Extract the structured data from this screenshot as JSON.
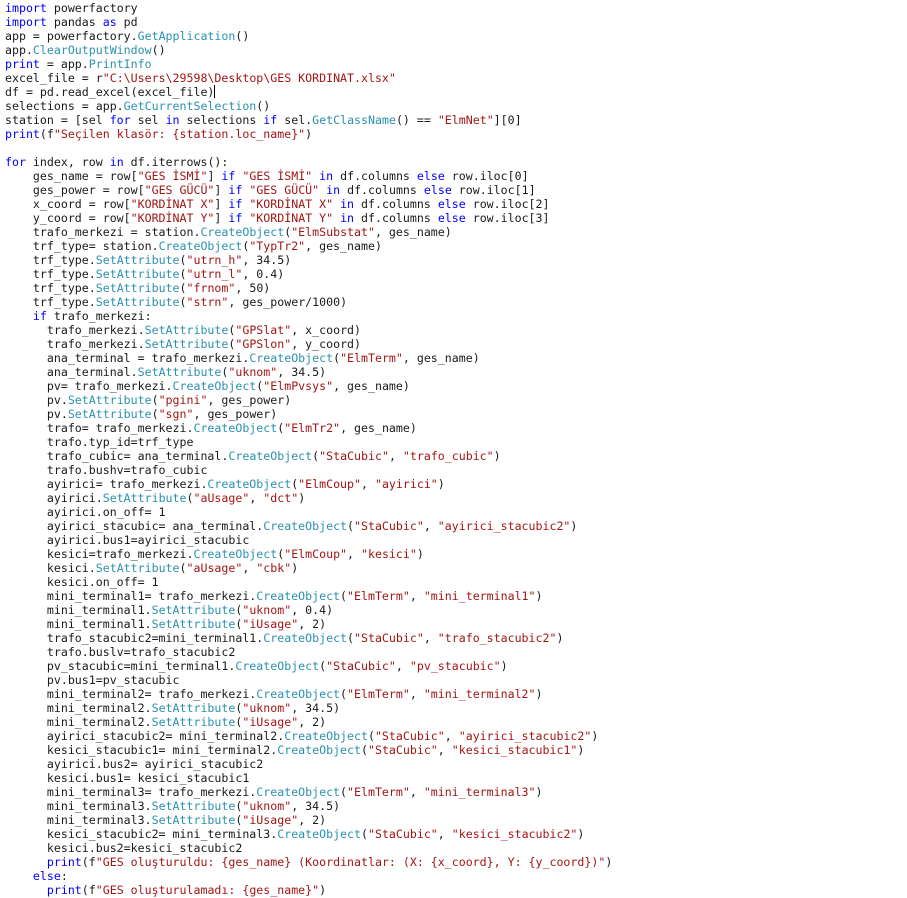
{
  "editor": {
    "lines": [
      [
        [
          "kw",
          "import"
        ],
        [
          "t",
          " powerfactory"
        ]
      ],
      [
        [
          "kw",
          "import"
        ],
        [
          "t",
          " pandas "
        ],
        [
          "kw",
          "as"
        ],
        [
          "t",
          " pd"
        ]
      ],
      [
        [
          "t",
          "app = powerfactory."
        ],
        [
          "fn",
          "GetApplication"
        ],
        [
          "t",
          "()"
        ]
      ],
      [
        [
          "t",
          "app."
        ],
        [
          "fn",
          "ClearOutputWindow"
        ],
        [
          "t",
          "()"
        ]
      ],
      [
        [
          "kw",
          "print"
        ],
        [
          "t",
          " = app."
        ],
        [
          "fn",
          "PrintInfo"
        ]
      ],
      [
        [
          "t",
          "excel_file = r"
        ],
        [
          "str",
          "\"C:\\Users\\29598\\Desktop\\GES KORDINAT.xlsx\""
        ]
      ],
      [
        [
          "t",
          "df = pd.read_excel(excel_file)"
        ]
      ],
      [
        [
          "t",
          "selections = app."
        ],
        [
          "fn",
          "GetCurrentSelection"
        ],
        [
          "t",
          "()"
        ]
      ],
      [
        [
          "t",
          "station = [sel "
        ],
        [
          "kw",
          "for"
        ],
        [
          "t",
          " sel "
        ],
        [
          "kw",
          "in"
        ],
        [
          "t",
          " selections "
        ],
        [
          "kw",
          "if"
        ],
        [
          "t",
          " sel."
        ],
        [
          "fn",
          "GetClassName"
        ],
        [
          "t",
          "() == "
        ],
        [
          "str",
          "\"ElmNet\""
        ],
        [
          "t",
          "][0]"
        ]
      ],
      [
        [
          "kw",
          "print"
        ],
        [
          "t",
          "(f"
        ],
        [
          "str",
          "\"Seçilen klasör: {station.loc_name}\""
        ],
        [
          "t",
          ")"
        ]
      ],
      [],
      [
        [
          "kw",
          "for"
        ],
        [
          "t",
          " index, row "
        ],
        [
          "kw",
          "in"
        ],
        [
          "t",
          " df.iterrows():"
        ]
      ],
      [
        [
          "t",
          "    ges_name = row["
        ],
        [
          "str",
          "\"GES İSMİ\""
        ],
        [
          "t",
          "] "
        ],
        [
          "kw",
          "if"
        ],
        [
          "t",
          " "
        ],
        [
          "str",
          "\"GES İSMİ\""
        ],
        [
          "t",
          " "
        ],
        [
          "kw",
          "in"
        ],
        [
          "t",
          " df.columns "
        ],
        [
          "kw",
          "else"
        ],
        [
          "t",
          " row.iloc[0]"
        ]
      ],
      [
        [
          "t",
          "    ges_power = row["
        ],
        [
          "str",
          "\"GES GÜCÜ\""
        ],
        [
          "t",
          "] "
        ],
        [
          "kw",
          "if"
        ],
        [
          "t",
          " "
        ],
        [
          "str",
          "\"GES GÜCÜ\""
        ],
        [
          "t",
          " "
        ],
        [
          "kw",
          "in"
        ],
        [
          "t",
          " df.columns "
        ],
        [
          "kw",
          "else"
        ],
        [
          "t",
          " row.iloc[1]"
        ]
      ],
      [
        [
          "t",
          "    x_coord = row["
        ],
        [
          "str",
          "\"KORDİNAT X\""
        ],
        [
          "t",
          "] "
        ],
        [
          "kw",
          "if"
        ],
        [
          "t",
          " "
        ],
        [
          "str",
          "\"KORDİNAT X\""
        ],
        [
          "t",
          " "
        ],
        [
          "kw",
          "in"
        ],
        [
          "t",
          " df.columns "
        ],
        [
          "kw",
          "else"
        ],
        [
          "t",
          " row.iloc[2]"
        ]
      ],
      [
        [
          "t",
          "    y_coord = row["
        ],
        [
          "str",
          "\"KORDİNAT Y\""
        ],
        [
          "t",
          "] "
        ],
        [
          "kw",
          "if"
        ],
        [
          "t",
          " "
        ],
        [
          "str",
          "\"KORDİNAT Y\""
        ],
        [
          "t",
          " "
        ],
        [
          "kw",
          "in"
        ],
        [
          "t",
          " df.columns "
        ],
        [
          "kw",
          "else"
        ],
        [
          "t",
          " row.iloc[3]"
        ]
      ],
      [
        [
          "t",
          "    trafo_merkezi = station."
        ],
        [
          "fn",
          "CreateObject"
        ],
        [
          "t",
          "("
        ],
        [
          "str",
          "\"ElmSubstat\""
        ],
        [
          "t",
          ", ges_name)"
        ]
      ],
      [
        [
          "t",
          "    trf_type= station."
        ],
        [
          "fn",
          "CreateObject"
        ],
        [
          "t",
          "("
        ],
        [
          "str",
          "\"TypTr2\""
        ],
        [
          "t",
          ", ges_name)"
        ]
      ],
      [
        [
          "t",
          "    trf_type."
        ],
        [
          "fn",
          "SetAttribute"
        ],
        [
          "t",
          "("
        ],
        [
          "str",
          "\"utrn_h\""
        ],
        [
          "t",
          ", 34.5)"
        ]
      ],
      [
        [
          "t",
          "    trf_type."
        ],
        [
          "fn",
          "SetAttribute"
        ],
        [
          "t",
          "("
        ],
        [
          "str",
          "\"utrn_l\""
        ],
        [
          "t",
          ", 0.4)"
        ]
      ],
      [
        [
          "t",
          "    trf_type."
        ],
        [
          "fn",
          "SetAttribute"
        ],
        [
          "t",
          "("
        ],
        [
          "str",
          "\"frnom\""
        ],
        [
          "t",
          ", 50)"
        ]
      ],
      [
        [
          "t",
          "    trf_type."
        ],
        [
          "fn",
          "SetAttribute"
        ],
        [
          "t",
          "("
        ],
        [
          "str",
          "\"strn\""
        ],
        [
          "t",
          ", ges_power/1000)"
        ]
      ],
      [
        [
          "t",
          "    "
        ],
        [
          "kw",
          "if"
        ],
        [
          "t",
          " trafo_merkezi:"
        ]
      ],
      [
        [
          "t",
          "      trafo_merkezi."
        ],
        [
          "fn",
          "SetAttribute"
        ],
        [
          "t",
          "("
        ],
        [
          "str",
          "\"GPSlat\""
        ],
        [
          "t",
          ", x_coord)"
        ]
      ],
      [
        [
          "t",
          "      trafo_merkezi."
        ],
        [
          "fn",
          "SetAttribute"
        ],
        [
          "t",
          "("
        ],
        [
          "str",
          "\"GPSlon\""
        ],
        [
          "t",
          ", y_coord)"
        ]
      ],
      [
        [
          "t",
          "      ana_terminal = trafo_merkezi."
        ],
        [
          "fn",
          "CreateObject"
        ],
        [
          "t",
          "("
        ],
        [
          "str",
          "\"ElmTerm\""
        ],
        [
          "t",
          ", ges_name)"
        ]
      ],
      [
        [
          "t",
          "      ana_terminal."
        ],
        [
          "fn",
          "SetAttribute"
        ],
        [
          "t",
          "("
        ],
        [
          "str",
          "\"uknom\""
        ],
        [
          "t",
          ", 34.5)"
        ]
      ],
      [
        [
          "t",
          "      pv= trafo_merkezi."
        ],
        [
          "fn",
          "CreateObject"
        ],
        [
          "t",
          "("
        ],
        [
          "str",
          "\"ElmPvsys\""
        ],
        [
          "t",
          ", ges_name)"
        ]
      ],
      [
        [
          "t",
          "      pv."
        ],
        [
          "fn",
          "SetAttribute"
        ],
        [
          "t",
          "("
        ],
        [
          "str",
          "\"pgini\""
        ],
        [
          "t",
          ", ges_power)"
        ]
      ],
      [
        [
          "t",
          "      pv."
        ],
        [
          "fn",
          "SetAttribute"
        ],
        [
          "t",
          "("
        ],
        [
          "str",
          "\"sgn\""
        ],
        [
          "t",
          ", ges_power)"
        ]
      ],
      [
        [
          "t",
          "      trafo= trafo_merkezi."
        ],
        [
          "fn",
          "CreateObject"
        ],
        [
          "t",
          "("
        ],
        [
          "str",
          "\"ElmTr2\""
        ],
        [
          "t",
          ", ges_name)"
        ]
      ],
      [
        [
          "t",
          "      trafo.typ_id=trf_type"
        ]
      ],
      [
        [
          "t",
          "      trafo_cubic= ana_terminal."
        ],
        [
          "fn",
          "CreateObject"
        ],
        [
          "t",
          "("
        ],
        [
          "str",
          "\"StaCubic\""
        ],
        [
          "t",
          ", "
        ],
        [
          "str",
          "\"trafo_cubic\""
        ],
        [
          "t",
          ")"
        ]
      ],
      [
        [
          "t",
          "      trafo.bushv=trafo_cubic"
        ]
      ],
      [
        [
          "t",
          "      ayirici= trafo_merkezi."
        ],
        [
          "fn",
          "CreateObject"
        ],
        [
          "t",
          "("
        ],
        [
          "str",
          "\"ElmCoup\""
        ],
        [
          "t",
          ", "
        ],
        [
          "str",
          "\"ayirici\""
        ],
        [
          "t",
          ")"
        ]
      ],
      [
        [
          "t",
          "      ayirici."
        ],
        [
          "fn",
          "SetAttribute"
        ],
        [
          "t",
          "("
        ],
        [
          "str",
          "\"aUsage\""
        ],
        [
          "t",
          ", "
        ],
        [
          "str",
          "\"dct\""
        ],
        [
          "t",
          ")"
        ]
      ],
      [
        [
          "t",
          "      ayirici.on_off= 1"
        ]
      ],
      [
        [
          "t",
          "      ayirici_stacubic= ana_terminal."
        ],
        [
          "fn",
          "CreateObject"
        ],
        [
          "t",
          "("
        ],
        [
          "str",
          "\"StaCubic\""
        ],
        [
          "t",
          ", "
        ],
        [
          "str",
          "\"ayirici_stacubic2\""
        ],
        [
          "t",
          ")"
        ]
      ],
      [
        [
          "t",
          "      ayirici.bus1=ayirici_stacubic"
        ]
      ],
      [
        [
          "t",
          "      kesici=trafo_merkezi."
        ],
        [
          "fn",
          "CreateObject"
        ],
        [
          "t",
          "("
        ],
        [
          "str",
          "\"ElmCoup\""
        ],
        [
          "t",
          ", "
        ],
        [
          "str",
          "\"kesici\""
        ],
        [
          "t",
          ")"
        ]
      ],
      [
        [
          "t",
          "      kesici."
        ],
        [
          "fn",
          "SetAttribute"
        ],
        [
          "t",
          "("
        ],
        [
          "str",
          "\"aUsage\""
        ],
        [
          "t",
          ", "
        ],
        [
          "str",
          "\"cbk\""
        ],
        [
          "t",
          ")"
        ]
      ],
      [
        [
          "t",
          "      kesici.on_off= 1"
        ]
      ],
      [
        [
          "t",
          "      mini_terminal1= trafo_merkezi."
        ],
        [
          "fn",
          "CreateObject"
        ],
        [
          "t",
          "("
        ],
        [
          "str",
          "\"ElmTerm\""
        ],
        [
          "t",
          ", "
        ],
        [
          "str",
          "\"mini_terminal1\""
        ],
        [
          "t",
          ")"
        ]
      ],
      [
        [
          "t",
          "      mini_terminal1."
        ],
        [
          "fn",
          "SetAttribute"
        ],
        [
          "t",
          "("
        ],
        [
          "str",
          "\"uknom\""
        ],
        [
          "t",
          ", 0.4)"
        ]
      ],
      [
        [
          "t",
          "      mini_terminal1."
        ],
        [
          "fn",
          "SetAttribute"
        ],
        [
          "t",
          "("
        ],
        [
          "str",
          "\"iUsage\""
        ],
        [
          "t",
          ", 2)"
        ]
      ],
      [
        [
          "t",
          "      trafo_stacubic2=mini_terminal1."
        ],
        [
          "fn",
          "CreateObject"
        ],
        [
          "t",
          "("
        ],
        [
          "str",
          "\"StaCubic\""
        ],
        [
          "t",
          ", "
        ],
        [
          "str",
          "\"trafo_stacubic2\""
        ],
        [
          "t",
          ")"
        ]
      ],
      [
        [
          "t",
          "      trafo.buslv=trafo_stacubic2"
        ]
      ],
      [
        [
          "t",
          "      pv_stacubic=mini_terminal1."
        ],
        [
          "fn",
          "CreateObject"
        ],
        [
          "t",
          "("
        ],
        [
          "str",
          "\"StaCubic\""
        ],
        [
          "t",
          ", "
        ],
        [
          "str",
          "\"pv_stacubic\""
        ],
        [
          "t",
          ")"
        ]
      ],
      [
        [
          "t",
          "      pv.bus1=pv_stacubic"
        ]
      ],
      [
        [
          "t",
          "      mini_terminal2= trafo_merkezi."
        ],
        [
          "fn",
          "CreateObject"
        ],
        [
          "t",
          "("
        ],
        [
          "str",
          "\"ElmTerm\""
        ],
        [
          "t",
          ", "
        ],
        [
          "str",
          "\"mini_terminal2\""
        ],
        [
          "t",
          ")"
        ]
      ],
      [
        [
          "t",
          "      mini_terminal2."
        ],
        [
          "fn",
          "SetAttribute"
        ],
        [
          "t",
          "("
        ],
        [
          "str",
          "\"uknom\""
        ],
        [
          "t",
          ", 34.5)"
        ]
      ],
      [
        [
          "t",
          "      mini_terminal2."
        ],
        [
          "fn",
          "SetAttribute"
        ],
        [
          "t",
          "("
        ],
        [
          "str",
          "\"iUsage\""
        ],
        [
          "t",
          ", 2)"
        ]
      ],
      [
        [
          "t",
          "      ayirici_stacubic2= mini_terminal2."
        ],
        [
          "fn",
          "CreateObject"
        ],
        [
          "t",
          "("
        ],
        [
          "str",
          "\"StaCubic\""
        ],
        [
          "t",
          ", "
        ],
        [
          "str",
          "\"ayirici_stacubic2\""
        ],
        [
          "t",
          ")"
        ]
      ],
      [
        [
          "t",
          "      kesici_stacubic1= mini_terminal2."
        ],
        [
          "fn",
          "CreateObject"
        ],
        [
          "t",
          "("
        ],
        [
          "str",
          "\"StaCubic\""
        ],
        [
          "t",
          ", "
        ],
        [
          "str",
          "\"kesici_stacubic1\""
        ],
        [
          "t",
          ")"
        ]
      ],
      [
        [
          "t",
          "      ayirici.bus2= ayirici_stacubic2"
        ]
      ],
      [
        [
          "t",
          "      kesici.bus1= kesici_stacubic1"
        ]
      ],
      [
        [
          "t",
          "      mini_terminal3= trafo_merkezi."
        ],
        [
          "fn",
          "CreateObject"
        ],
        [
          "t",
          "("
        ],
        [
          "str",
          "\"ElmTerm\""
        ],
        [
          "t",
          ", "
        ],
        [
          "str",
          "\"mini_terminal3\""
        ],
        [
          "t",
          ")"
        ]
      ],
      [
        [
          "t",
          "      mini_terminal3."
        ],
        [
          "fn",
          "SetAttribute"
        ],
        [
          "t",
          "("
        ],
        [
          "str",
          "\"uknom\""
        ],
        [
          "t",
          ", 34.5)"
        ]
      ],
      [
        [
          "t",
          "      mini_terminal3."
        ],
        [
          "fn",
          "SetAttribute"
        ],
        [
          "t",
          "("
        ],
        [
          "str",
          "\"iUsage\""
        ],
        [
          "t",
          ", 2)"
        ]
      ],
      [
        [
          "t",
          "      kesici_stacubic2= mini_terminal3."
        ],
        [
          "fn",
          "CreateObject"
        ],
        [
          "t",
          "("
        ],
        [
          "str",
          "\"StaCubic\""
        ],
        [
          "t",
          ", "
        ],
        [
          "str",
          "\"kesici_stacubic2\""
        ],
        [
          "t",
          ")"
        ]
      ],
      [
        [
          "t",
          "      kesici.bus2=kesici_stacubic2"
        ]
      ],
      [
        [
          "t",
          "      "
        ],
        [
          "kw",
          "print"
        ],
        [
          "t",
          "(f"
        ],
        [
          "str",
          "\"GES oluşturuldu: {ges_name} (Koordinatlar: (X: {x_coord}, Y: {y_coord})\""
        ],
        [
          "t",
          ")"
        ]
      ],
      [
        [
          "t",
          "    "
        ],
        [
          "kw",
          "else"
        ],
        [
          "t",
          ":"
        ]
      ],
      [
        [
          "t",
          "      "
        ],
        [
          "kw",
          "print"
        ],
        [
          "t",
          "(f"
        ],
        [
          "str",
          "\"GES oluşturulamadı: {ges_name}\""
        ],
        [
          "t",
          ")"
        ]
      ]
    ]
  }
}
